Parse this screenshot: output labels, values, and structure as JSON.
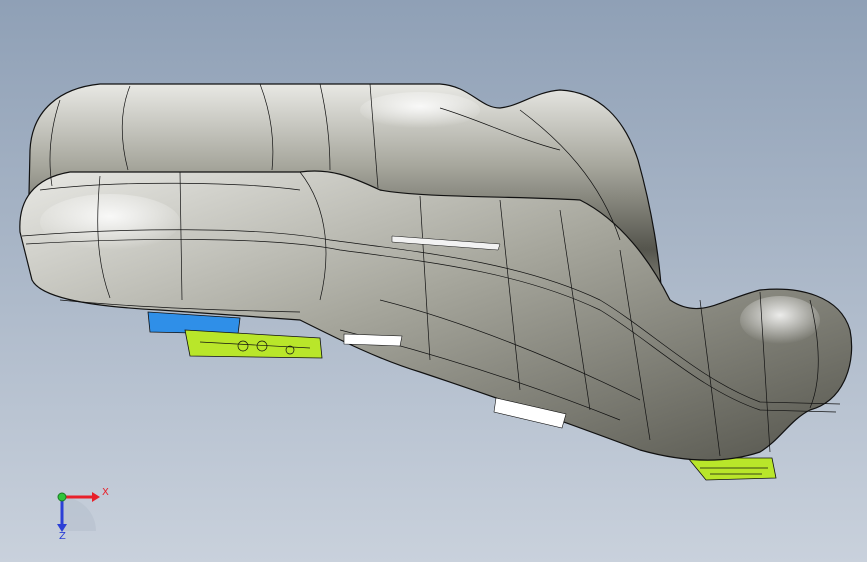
{
  "viewport": {
    "background_top": "#8fa0b6",
    "background_bottom": "#c9d1dc"
  },
  "model": {
    "body_light": "#e8e8e4",
    "body_mid": "#a6a69c",
    "body_dark": "#55554d",
    "edge_color": "#111111",
    "bracket_blue": "#2f8fe8",
    "bracket_green": "#b9e62a",
    "label_white": "#ffffff"
  },
  "triad": {
    "x_label": "X",
    "z_label": "Z",
    "x_color": "#e8202a",
    "y_color": "#2fc43a",
    "z_color": "#2b3fd6"
  }
}
